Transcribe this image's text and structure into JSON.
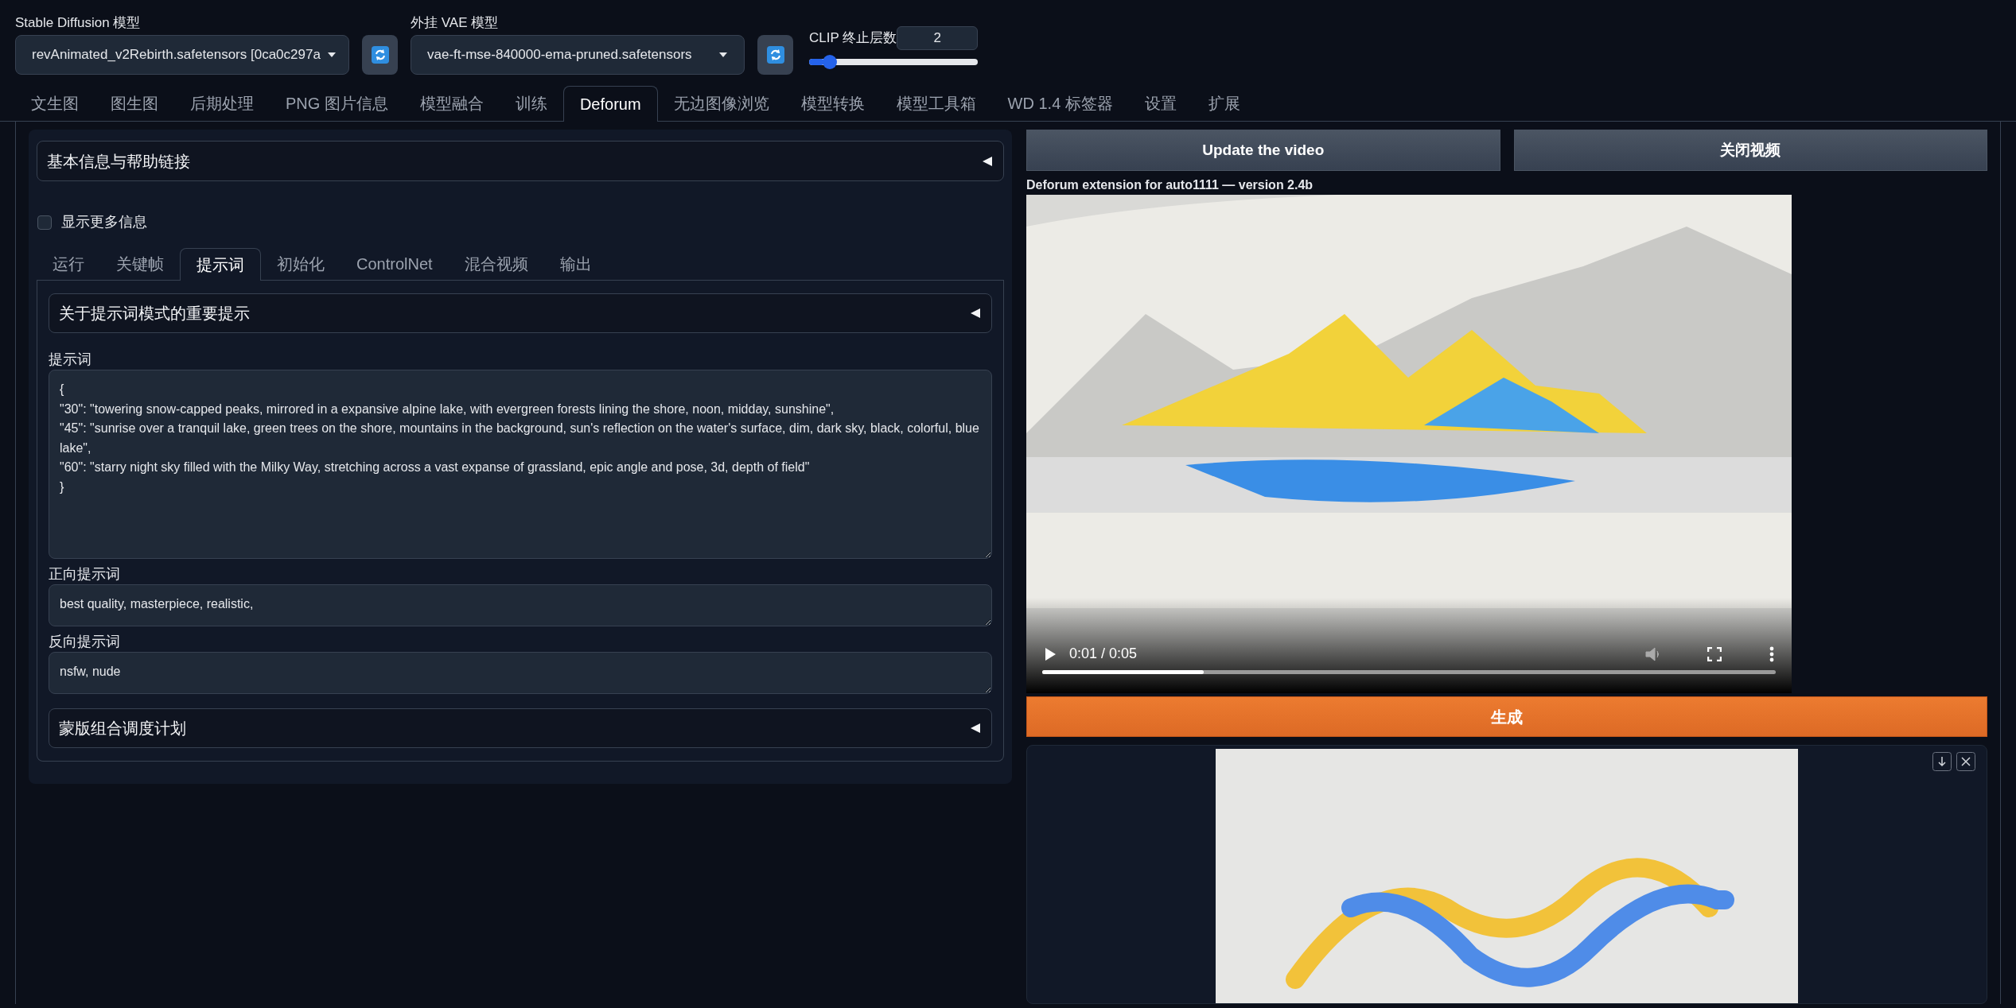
{
  "model_bar": {
    "sd_model": {
      "label": "Stable Diffusion 模型",
      "value": "revAnimated_v2Rebirth.safetensors [0ca0c297a"
    },
    "vae_model": {
      "label": "外挂 VAE 模型",
      "value": "vae-ft-mse-840000-ema-pruned.safetensors"
    },
    "clip_skip": {
      "label": "CLIP 终止层数",
      "value": "2",
      "level": 0.09
    }
  },
  "tabs": [
    {
      "label": "文生图",
      "selected": false
    },
    {
      "label": "图生图",
      "selected": false
    },
    {
      "label": "后期处理",
      "selected": false
    },
    {
      "label": "PNG 图片信息",
      "selected": false
    },
    {
      "label": "模型融合",
      "selected": false
    },
    {
      "label": "训练",
      "selected": false
    },
    {
      "label": "Deforum",
      "selected": true
    },
    {
      "label": "无边图像浏览",
      "selected": false
    },
    {
      "label": "模型转换",
      "selected": false
    },
    {
      "label": "模型工具箱",
      "selected": false
    },
    {
      "label": "WD 1.4 标签器",
      "selected": false
    },
    {
      "label": "设置",
      "selected": false
    },
    {
      "label": "扩展",
      "selected": false
    }
  ],
  "left": {
    "info_accordion": {
      "title": "基本信息与帮助链接",
      "open": false
    },
    "show_more": {
      "label": "显示更多信息",
      "checked": false
    },
    "subtabs": [
      {
        "label": "运行",
        "selected": false
      },
      {
        "label": "关键帧",
        "selected": false
      },
      {
        "label": "提示词",
        "selected": true
      },
      {
        "label": "初始化",
        "selected": false
      },
      {
        "label": "ControlNet",
        "selected": false
      },
      {
        "label": "混合视频",
        "selected": false
      },
      {
        "label": "输出",
        "selected": false
      }
    ],
    "notice_accordion": {
      "title": "关于提示词模式的重要提示",
      "open": false
    },
    "fields": [
      {
        "label": "提示词",
        "value": "{\n\"30\": \"towering snow-capped peaks, mirrored in a expansive alpine lake, with evergreen forests lining the shore, noon, midday, sunshine\",\n\"45\": \"sunrise over a tranquil lake, green trees on the shore, mountains in the background, sun's reflection on the water's surface, dim, dark sky, black, colorful, blue lake\",\n\"60\": \"starry night sky filled with the Milky Way, stretching across a vast expanse of grassland, epic angle and pose, 3d, depth of field\"\n}",
        "kind": "large"
      },
      {
        "label": "正向提示词",
        "value": "best quality, masterpiece, realistic,",
        "kind": "small"
      },
      {
        "label": "反向提示词",
        "value": "nsfw, nude",
        "kind": "small"
      }
    ],
    "mask_accordion": {
      "title": "蒙版组合调度计划",
      "open": false
    }
  },
  "right": {
    "buttons": [
      {
        "label": "Update the video"
      },
      {
        "label": "关闭视频"
      }
    ],
    "caption": "Deforum extension for auto1111 — version 2.4b",
    "video": {
      "time": "0:01 / 0:05",
      "level": 0.22
    },
    "generate": {
      "label": "生成"
    }
  }
}
